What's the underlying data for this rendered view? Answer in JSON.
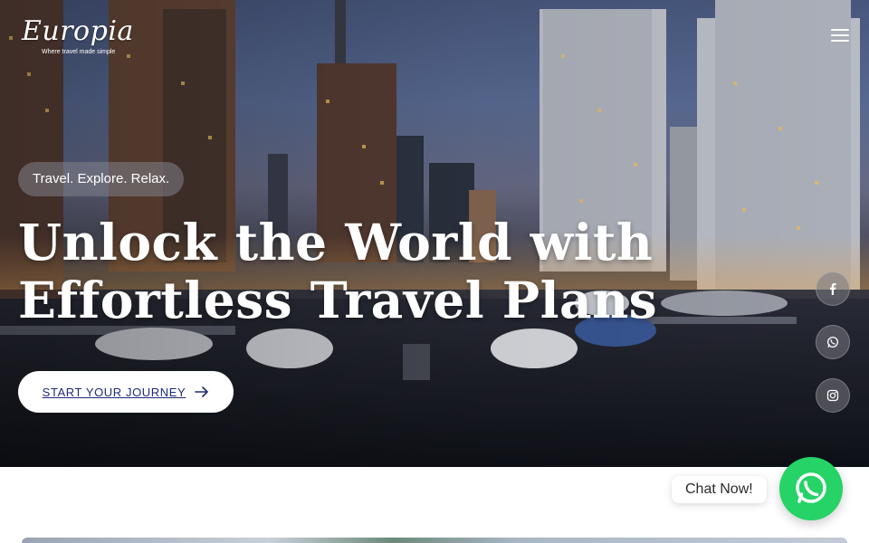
{
  "brand": {
    "name": "Europia",
    "tagline": "Where travel made simple"
  },
  "hero": {
    "eyebrow": "Travel. Explore. Relax.",
    "headline_line1": "Unlock the World with",
    "headline_line2": "Effortless Travel Plans",
    "cta_label": "START YOUR JOURNEY"
  },
  "social": [
    {
      "icon": "facebook-icon"
    },
    {
      "icon": "whatsapp-icon"
    },
    {
      "icon": "instagram-icon"
    }
  ],
  "chat": {
    "label": "Chat Now!",
    "icon": "whatsapp-icon"
  },
  "colors": {
    "cta_text": "#1e2a78",
    "chat_green": "#25d366",
    "hero_sky": "#5c6e98"
  }
}
